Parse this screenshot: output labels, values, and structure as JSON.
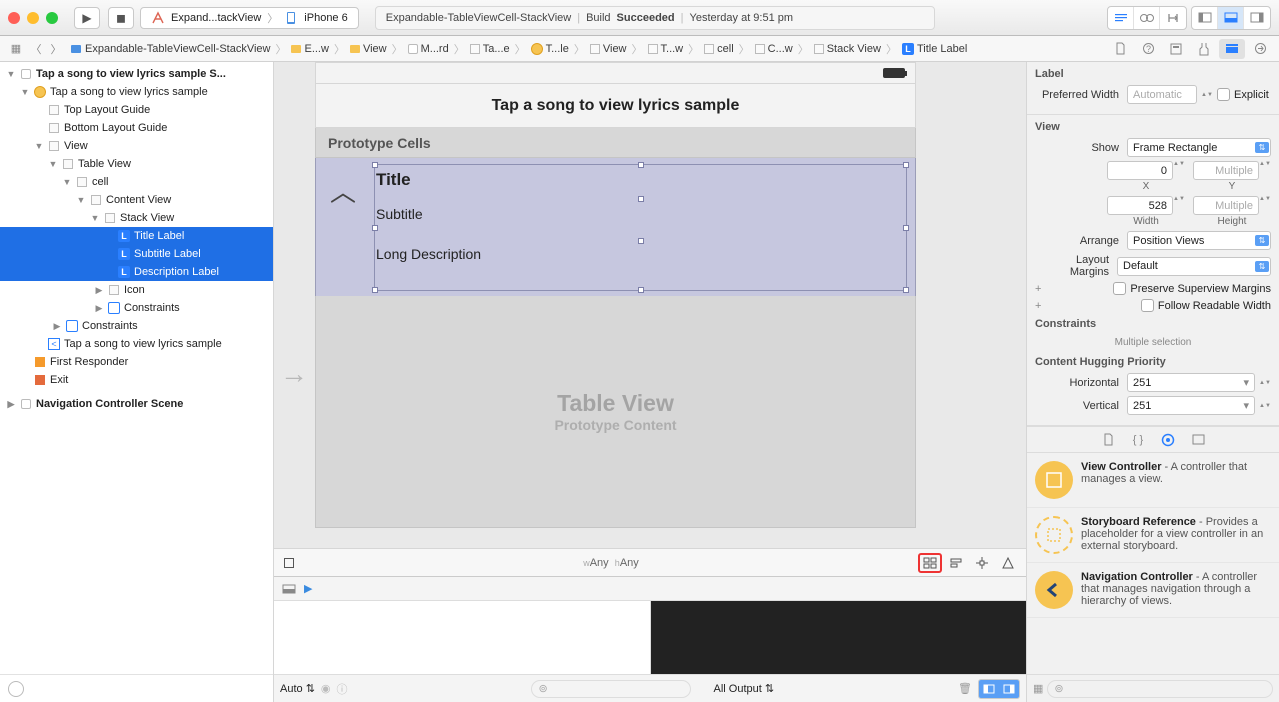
{
  "titlebar": {
    "scheme_name": "Expand...tackView",
    "device_name": "iPhone 6",
    "status_project": "Expandable-TableViewCell-StackView",
    "status_build_label": "Build",
    "status_build_result": "Succeeded",
    "status_time": "Yesterday at 9:51 pm"
  },
  "jumpbar": {
    "crumbs": [
      "Expandable-TableViewCell-StackView",
      "E...w",
      "View",
      "M...rd",
      "Ta...e",
      "T...le",
      "View",
      "T...w",
      "cell",
      "C...w",
      "Stack View",
      "Title Label"
    ]
  },
  "outline": {
    "scene1": "Tap a song to view lyrics sample S...",
    "vc": "Tap a song to view lyrics sample",
    "top_guide": "Top Layout Guide",
    "bottom_guide": "Bottom Layout Guide",
    "view": "View",
    "table_view": "Table View",
    "cell": "cell",
    "content_view": "Content View",
    "stack_view": "Stack View",
    "title_label": "Title Label",
    "subtitle_label": "Subtitle Label",
    "description_label": "Description Label",
    "icon": "Icon",
    "constraints": "Constraints",
    "constraints2": "Constraints",
    "nav_item": "Tap a song to view lyrics sample",
    "first_responder": "First Responder",
    "exit": "Exit",
    "nav_scene": "Navigation Controller Scene"
  },
  "canvas": {
    "nav_title": "Tap a song to view lyrics sample",
    "prototype_cells": "Prototype Cells",
    "title": "Title",
    "subtitle": "Subtitle",
    "long_desc": "Long Description",
    "tv_big": "Table View",
    "tv_small": "Prototype Content",
    "size_w_prefix": "w",
    "size_w": "Any",
    "size_h_prefix": "h",
    "size_h": "Any"
  },
  "debug": {
    "auto": "Auto",
    "all_output": "All Output"
  },
  "inspector": {
    "label_header": "Label",
    "preferred_width": "Preferred Width",
    "preferred_width_val": "Automatic",
    "explicit": "Explicit",
    "view_header": "View",
    "show": "Show",
    "show_val": "Frame Rectangle",
    "x_val": "0",
    "x_label": "X",
    "y_val": "Multiple",
    "y_label": "Y",
    "w_val": "528",
    "w_label": "Width",
    "h_val": "Multiple",
    "h_label": "Height",
    "arrange": "Arrange",
    "arrange_val": "Position Views",
    "layout_margins": "Layout Margins",
    "layout_margins_val": "Default",
    "preserve": "Preserve Superview Margins",
    "follow": "Follow Readable Width",
    "constraints_header": "Constraints",
    "multiple_selection": "Multiple selection",
    "chp": "Content Hugging Priority",
    "horizontal": "Horizontal",
    "horizontal_val": "251",
    "vertical": "Vertical",
    "vertical_val": "251"
  },
  "library": {
    "vc_title": "View Controller",
    "vc_desc": " - A controller that manages a view.",
    "ref_title": "Storyboard Reference",
    "ref_desc": " - Provides a placeholder for a view controller in an external storyboard.",
    "nav_title": "Navigation Controller",
    "nav_desc": " - A controller that manages navigation through a hierarchy of views."
  }
}
